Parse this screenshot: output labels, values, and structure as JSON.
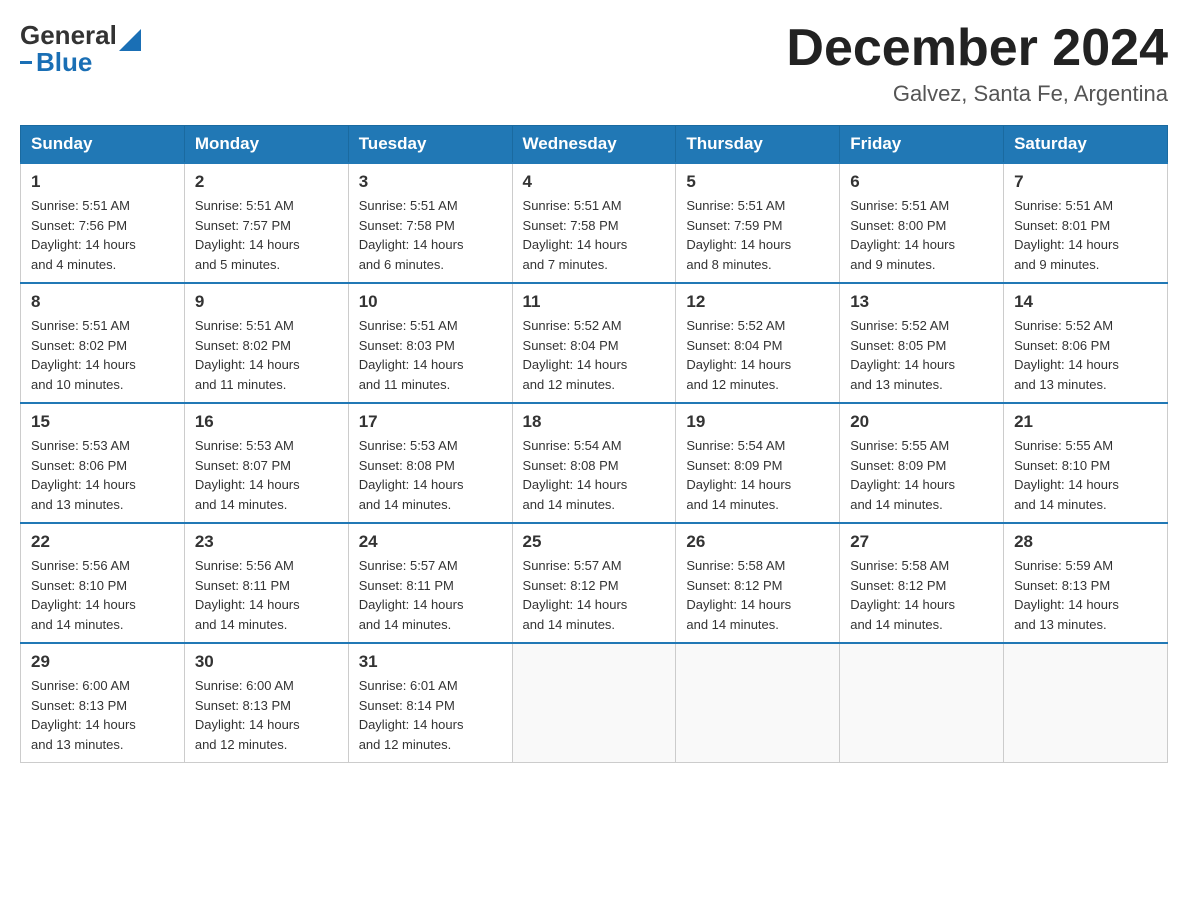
{
  "header": {
    "logo_general": "General",
    "logo_blue": "Blue",
    "month_title": "December 2024",
    "location": "Galvez, Santa Fe, Argentina"
  },
  "days_of_week": [
    "Sunday",
    "Monday",
    "Tuesday",
    "Wednesday",
    "Thursday",
    "Friday",
    "Saturday"
  ],
  "weeks": [
    [
      {
        "day": "1",
        "sunrise": "5:51 AM",
        "sunset": "7:56 PM",
        "daylight": "14 hours and 4 minutes."
      },
      {
        "day": "2",
        "sunrise": "5:51 AM",
        "sunset": "7:57 PM",
        "daylight": "14 hours and 5 minutes."
      },
      {
        "day": "3",
        "sunrise": "5:51 AM",
        "sunset": "7:58 PM",
        "daylight": "14 hours and 6 minutes."
      },
      {
        "day": "4",
        "sunrise": "5:51 AM",
        "sunset": "7:58 PM",
        "daylight": "14 hours and 7 minutes."
      },
      {
        "day": "5",
        "sunrise": "5:51 AM",
        "sunset": "7:59 PM",
        "daylight": "14 hours and 8 minutes."
      },
      {
        "day": "6",
        "sunrise": "5:51 AM",
        "sunset": "8:00 PM",
        "daylight": "14 hours and 9 minutes."
      },
      {
        "day": "7",
        "sunrise": "5:51 AM",
        "sunset": "8:01 PM",
        "daylight": "14 hours and 9 minutes."
      }
    ],
    [
      {
        "day": "8",
        "sunrise": "5:51 AM",
        "sunset": "8:02 PM",
        "daylight": "14 hours and 10 minutes."
      },
      {
        "day": "9",
        "sunrise": "5:51 AM",
        "sunset": "8:02 PM",
        "daylight": "14 hours and 11 minutes."
      },
      {
        "day": "10",
        "sunrise": "5:51 AM",
        "sunset": "8:03 PM",
        "daylight": "14 hours and 11 minutes."
      },
      {
        "day": "11",
        "sunrise": "5:52 AM",
        "sunset": "8:04 PM",
        "daylight": "14 hours and 12 minutes."
      },
      {
        "day": "12",
        "sunrise": "5:52 AM",
        "sunset": "8:04 PM",
        "daylight": "14 hours and 12 minutes."
      },
      {
        "day": "13",
        "sunrise": "5:52 AM",
        "sunset": "8:05 PM",
        "daylight": "14 hours and 13 minutes."
      },
      {
        "day": "14",
        "sunrise": "5:52 AM",
        "sunset": "8:06 PM",
        "daylight": "14 hours and 13 minutes."
      }
    ],
    [
      {
        "day": "15",
        "sunrise": "5:53 AM",
        "sunset": "8:06 PM",
        "daylight": "14 hours and 13 minutes."
      },
      {
        "day": "16",
        "sunrise": "5:53 AM",
        "sunset": "8:07 PM",
        "daylight": "14 hours and 14 minutes."
      },
      {
        "day": "17",
        "sunrise": "5:53 AM",
        "sunset": "8:08 PM",
        "daylight": "14 hours and 14 minutes."
      },
      {
        "day": "18",
        "sunrise": "5:54 AM",
        "sunset": "8:08 PM",
        "daylight": "14 hours and 14 minutes."
      },
      {
        "day": "19",
        "sunrise": "5:54 AM",
        "sunset": "8:09 PM",
        "daylight": "14 hours and 14 minutes."
      },
      {
        "day": "20",
        "sunrise": "5:55 AM",
        "sunset": "8:09 PM",
        "daylight": "14 hours and 14 minutes."
      },
      {
        "day": "21",
        "sunrise": "5:55 AM",
        "sunset": "8:10 PM",
        "daylight": "14 hours and 14 minutes."
      }
    ],
    [
      {
        "day": "22",
        "sunrise": "5:56 AM",
        "sunset": "8:10 PM",
        "daylight": "14 hours and 14 minutes."
      },
      {
        "day": "23",
        "sunrise": "5:56 AM",
        "sunset": "8:11 PM",
        "daylight": "14 hours and 14 minutes."
      },
      {
        "day": "24",
        "sunrise": "5:57 AM",
        "sunset": "8:11 PM",
        "daylight": "14 hours and 14 minutes."
      },
      {
        "day": "25",
        "sunrise": "5:57 AM",
        "sunset": "8:12 PM",
        "daylight": "14 hours and 14 minutes."
      },
      {
        "day": "26",
        "sunrise": "5:58 AM",
        "sunset": "8:12 PM",
        "daylight": "14 hours and 14 minutes."
      },
      {
        "day": "27",
        "sunrise": "5:58 AM",
        "sunset": "8:12 PM",
        "daylight": "14 hours and 14 minutes."
      },
      {
        "day": "28",
        "sunrise": "5:59 AM",
        "sunset": "8:13 PM",
        "daylight": "14 hours and 13 minutes."
      }
    ],
    [
      {
        "day": "29",
        "sunrise": "6:00 AM",
        "sunset": "8:13 PM",
        "daylight": "14 hours and 13 minutes."
      },
      {
        "day": "30",
        "sunrise": "6:00 AM",
        "sunset": "8:13 PM",
        "daylight": "14 hours and 12 minutes."
      },
      {
        "day": "31",
        "sunrise": "6:01 AM",
        "sunset": "8:14 PM",
        "daylight": "14 hours and 12 minutes."
      },
      null,
      null,
      null,
      null
    ]
  ],
  "labels": {
    "sunrise_prefix": "Sunrise: ",
    "sunset_prefix": "Sunset: ",
    "daylight_prefix": "Daylight: "
  }
}
